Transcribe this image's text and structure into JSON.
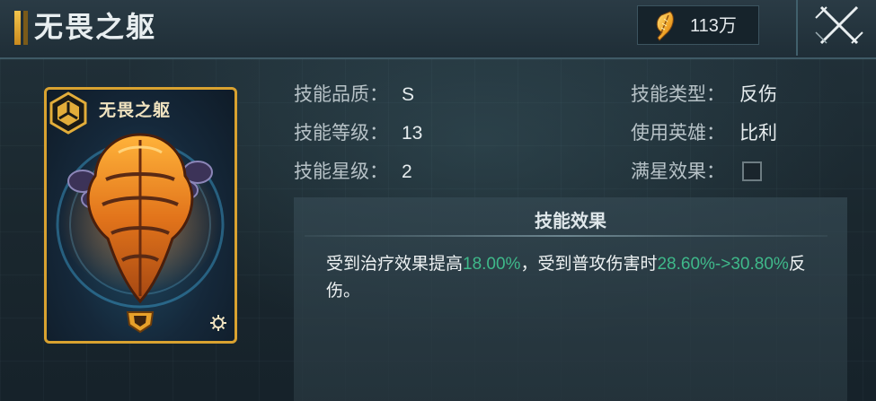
{
  "header": {
    "title": "无畏之躯",
    "currency": {
      "icon": "gold-feather-icon",
      "value": "113万"
    },
    "close_icon": "close-icon"
  },
  "card": {
    "name": "无畏之躯",
    "badge_icon": "hexagon-emblem-icon",
    "art_icon": "orange-armor-helmet-icon",
    "corner_icon": "gear-icon",
    "frame_color": "#d9a230"
  },
  "info": {
    "quality_label": "技能品质：",
    "quality_value": "S",
    "level_label": "技能等级：",
    "level_value": "13",
    "star_label": "技能星级：",
    "star_value": "2",
    "type_label": "技能类型：",
    "type_value": "反伤",
    "hero_label": "使用英雄：",
    "hero_value": "比利",
    "maxstar_label": "满星效果：",
    "maxstar_checked": false
  },
  "effect": {
    "title": "技能效果",
    "text_1": "受到治疗效果提高",
    "value_1": "18.00%",
    "text_2": "，受到普攻伤害时",
    "value_2": "28.60%->30.80%",
    "text_3": "反伤。",
    "highlight_color": "#3fb98a"
  }
}
